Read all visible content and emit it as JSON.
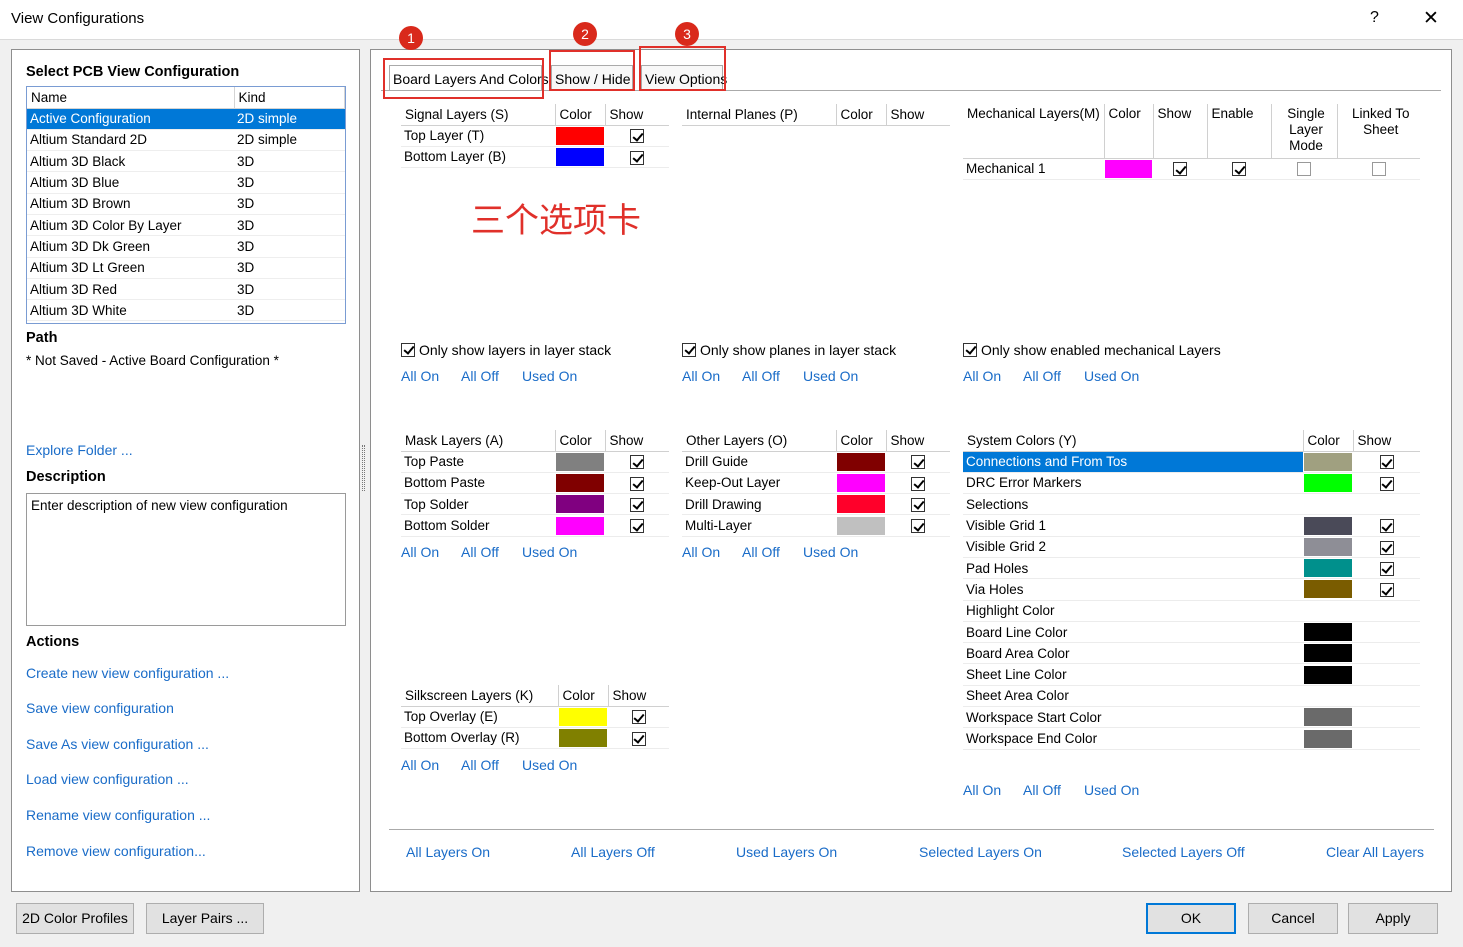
{
  "window": {
    "title": "View Configurations",
    "help": "?",
    "close": "✕"
  },
  "left": {
    "select_header": "Select PCB View Configuration",
    "list_columns": [
      "Name",
      "Kind"
    ],
    "configs": [
      {
        "name": "Active Configuration",
        "kind": "2D simple"
      },
      {
        "name": "Altium Standard 2D",
        "kind": "2D simple"
      },
      {
        "name": "Altium 3D Black",
        "kind": "3D"
      },
      {
        "name": "Altium 3D Blue",
        "kind": "3D"
      },
      {
        "name": "Altium 3D Brown",
        "kind": "3D"
      },
      {
        "name": "Altium 3D Color By Layer",
        "kind": "3D"
      },
      {
        "name": "Altium 3D Dk Green",
        "kind": "3D"
      },
      {
        "name": "Altium 3D Lt Green",
        "kind": "3D"
      },
      {
        "name": "Altium 3D Red",
        "kind": "3D"
      },
      {
        "name": "Altium 3D White",
        "kind": "3D"
      }
    ],
    "path_header": "Path",
    "path_value": "* Not Saved - Active Board Configuration *",
    "explore_folder": "Explore Folder ...",
    "description_header": "Description",
    "description_value": "Enter description of new view configuration",
    "actions_header": "Actions",
    "actions": [
      "Create new view configuration ...",
      "Save view configuration",
      "Save As view configuration ...",
      "Load view configuration ...",
      "Rename view configuration ...",
      "Remove view configuration..."
    ]
  },
  "tabs": [
    "Board Layers And Colors",
    "Show / Hide",
    "View Options"
  ],
  "badges": [
    "1",
    "2",
    "3"
  ],
  "annotation": "三个选项卡",
  "link_labels": {
    "all_on": "All On",
    "all_off": "All Off",
    "used_on": "Used On"
  },
  "signal": {
    "columns": [
      "Signal Layers (S)",
      "Color",
      "Show"
    ],
    "rows": [
      {
        "name": "Top Layer (T)",
        "color": "#ff0000",
        "show": true
      },
      {
        "name": "Bottom Layer (B)",
        "color": "#0000ff",
        "show": true
      }
    ],
    "filter": "Only show layers in layer stack"
  },
  "planes": {
    "columns": [
      "Internal Planes (P)",
      "Color",
      "Show"
    ],
    "rows": [],
    "filter": "Only show planes in layer stack"
  },
  "mech": {
    "columns": [
      "Mechanical Layers(M)",
      "Color",
      "Show",
      "Enable",
      "Single Layer Mode",
      "Linked To Sheet"
    ],
    "rows": [
      {
        "name": "Mechanical 1",
        "color": "#ff00ff",
        "show": true,
        "enable": true,
        "single": false,
        "linked": false
      }
    ],
    "filter": "Only show enabled mechanical Layers"
  },
  "mask": {
    "columns": [
      "Mask Layers (A)",
      "Color",
      "Show"
    ],
    "rows": [
      {
        "name": "Top Paste",
        "color": "#808080",
        "show": true
      },
      {
        "name": "Bottom Paste",
        "color": "#800000",
        "show": true
      },
      {
        "name": "Top Solder",
        "color": "#800080",
        "show": true
      },
      {
        "name": "Bottom Solder",
        "color": "#ff00ff",
        "show": true
      }
    ]
  },
  "other": {
    "columns": [
      "Other Layers (O)",
      "Color",
      "Show"
    ],
    "rows": [
      {
        "name": "Drill Guide",
        "color": "#800000",
        "show": true
      },
      {
        "name": "Keep-Out Layer",
        "color": "#ff00ff",
        "show": true
      },
      {
        "name": "Drill Drawing",
        "color": "#ff002a",
        "show": true
      },
      {
        "name": "Multi-Layer",
        "color": "#c0c0c0",
        "show": true
      }
    ]
  },
  "silk": {
    "columns": [
      "Silkscreen Layers (K)",
      "Color",
      "Show"
    ],
    "rows": [
      {
        "name": "Top Overlay (E)",
        "color": "#ffff00",
        "show": true
      },
      {
        "name": "Bottom Overlay (R)",
        "color": "#808000",
        "show": true
      }
    ]
  },
  "system": {
    "columns": [
      "System Colors (Y)",
      "Color",
      "Show"
    ],
    "rows": [
      {
        "name": "Connections and From Tos",
        "color": "#a0a080",
        "show": true,
        "has_show": true,
        "selected": true
      },
      {
        "name": "DRC Error Markers",
        "color": "#00ff00",
        "show": true,
        "has_show": true
      },
      {
        "name": "Selections",
        "color": "#ffffff",
        "show": false,
        "has_show": false
      },
      {
        "name": "Visible Grid 1",
        "color": "#4a4a58",
        "show": true,
        "has_show": true
      },
      {
        "name": "Visible Grid 2",
        "color": "#8e8e96",
        "show": true,
        "has_show": true
      },
      {
        "name": "Pad Holes",
        "color": "#00908c",
        "show": true,
        "has_show": true
      },
      {
        "name": "Via Holes",
        "color": "#7a5c00",
        "show": true,
        "has_show": true
      },
      {
        "name": "Highlight Color",
        "color": "#ffffff",
        "show": false,
        "has_show": false
      },
      {
        "name": "Board Line Color",
        "color": "#000000",
        "show": false,
        "has_show": false
      },
      {
        "name": "Board Area Color",
        "color": "#000000",
        "show": false,
        "has_show": false
      },
      {
        "name": "Sheet Line Color",
        "color": "#000000",
        "show": false,
        "has_show": false
      },
      {
        "name": "Sheet Area Color",
        "color": "#ffffff",
        "show": false,
        "has_show": false
      },
      {
        "name": "Workspace Start Color",
        "color": "#6a6a6a",
        "show": false,
        "has_show": false
      },
      {
        "name": "Workspace End Color",
        "color": "#6a6a6a",
        "show": false,
        "has_show": false
      }
    ]
  },
  "bottom_links": [
    "All Layers On",
    "All Layers Off",
    "Used Layers On",
    "Selected Layers On",
    "Selected Layers Off",
    "Clear All Layers"
  ],
  "footer": {
    "color_profiles": "2D Color Profiles",
    "layer_pairs": "Layer Pairs ...",
    "ok": "OK",
    "cancel": "Cancel",
    "apply": "Apply"
  }
}
